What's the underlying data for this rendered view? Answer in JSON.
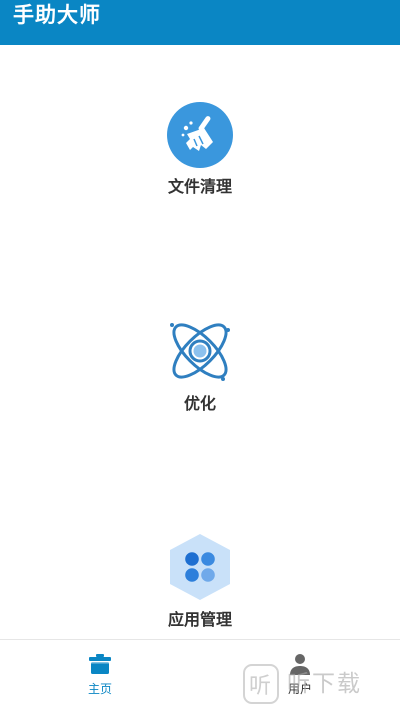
{
  "header": {
    "title": "手助大师",
    "color": "#0a86c4"
  },
  "features": [
    {
      "label": "文件清理",
      "icon": "broom-icon"
    },
    {
      "label": "优化",
      "icon": "atom-icon"
    },
    {
      "label": "应用管理",
      "icon": "app-grid-icon"
    }
  ],
  "bottom_nav": {
    "items": [
      {
        "label": "主页",
        "icon": "home-box-icon",
        "active": true
      },
      {
        "label": "用户",
        "icon": "user-icon",
        "active": false
      }
    ]
  },
  "watermark": {
    "logo_text": "听",
    "text": "听下载"
  }
}
